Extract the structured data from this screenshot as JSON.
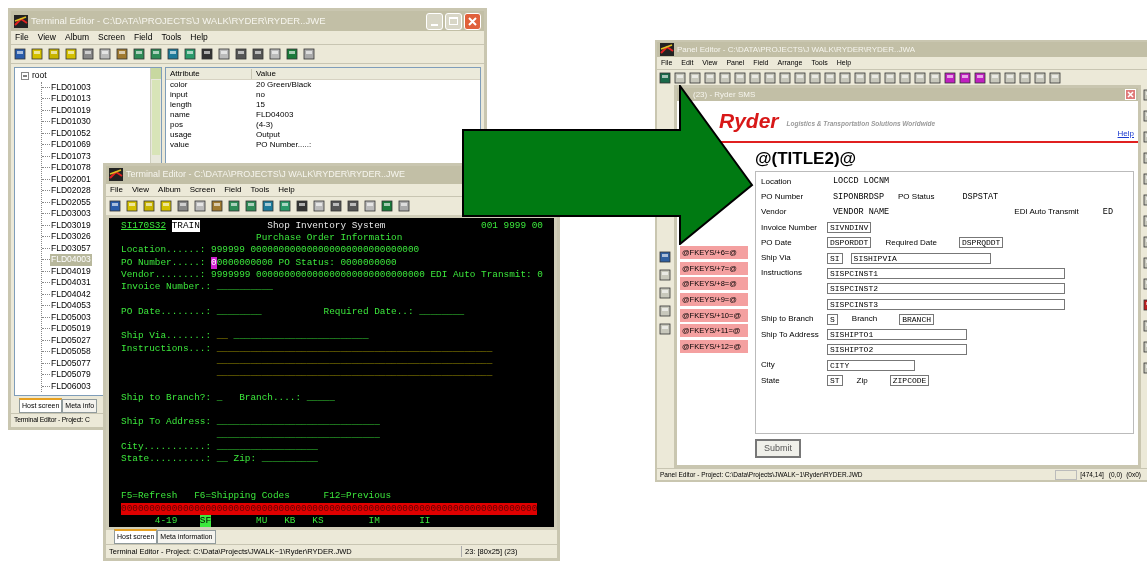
{
  "terminal_editor_back": {
    "title": "Terminal Editor - C:\\DATA\\PROJECTS\\J WALK\\RYDER\\RYDER..JWE",
    "menu": [
      "File",
      "View",
      "Album",
      "Screen",
      "Field",
      "Tools",
      "Help"
    ],
    "tree": {
      "label": "root",
      "expanded": true,
      "children": [
        {
          "label": "FLD01003",
          "selected": false
        },
        {
          "label": "FLD01013",
          "selected": false
        },
        {
          "label": "FLD01019",
          "selected": false
        },
        {
          "label": "FLD01030",
          "selected": false
        },
        {
          "label": "FLD01052",
          "selected": false
        },
        {
          "label": "FLD01069",
          "selected": false
        },
        {
          "label": "FLD01073",
          "selected": false
        },
        {
          "label": "FLD01078",
          "selected": false
        },
        {
          "label": "FLD02001",
          "selected": false
        },
        {
          "label": "FLD02028",
          "selected": false
        },
        {
          "label": "FLD02055",
          "selected": false
        },
        {
          "label": "FLD03003",
          "selected": false
        },
        {
          "label": "FLD03019",
          "selected": false
        },
        {
          "label": "FLD03026",
          "selected": false
        },
        {
          "label": "FLD03057",
          "selected": false
        },
        {
          "label": "FLD04003",
          "selected": true
        },
        {
          "label": "FLD04019",
          "selected": false
        },
        {
          "label": "FLD04031",
          "selected": false
        },
        {
          "label": "FLD04042",
          "selected": false
        },
        {
          "label": "FLD04053",
          "selected": false
        },
        {
          "label": "FLD05003",
          "selected": false
        },
        {
          "label": "FLD05019",
          "selected": false
        },
        {
          "label": "FLD05027",
          "selected": false
        },
        {
          "label": "FLD05058",
          "selected": false
        },
        {
          "label": "FLD05077",
          "selected": false
        },
        {
          "label": "FLD05079",
          "selected": false
        },
        {
          "label": "FLD06003",
          "selected": false
        }
      ]
    },
    "attributes": {
      "columns": [
        "Attribute",
        "Value"
      ],
      "rows": [
        {
          "attribute": "color",
          "value": "20 Green/Black"
        },
        {
          "attribute": "input",
          "value": "no"
        },
        {
          "attribute": "length",
          "value": "15"
        },
        {
          "attribute": "name",
          "value": "FLD04003"
        },
        {
          "attribute": "pos",
          "value": "(4-3)"
        },
        {
          "attribute": "usage",
          "value": "Output"
        },
        {
          "attribute": "value",
          "value": "PO Number.....:"
        }
      ]
    },
    "tabs": [
      {
        "label": "Host screen",
        "selected": true
      },
      {
        "label": "Meta info",
        "selected": false
      }
    ],
    "status": "Terminal Editor - Project: C"
  },
  "terminal_editor_front": {
    "title": "Terminal Editor - C:\\DATA\\PROJECTS\\J WALK\\RYDER\\RYDER..JWE",
    "menu": [
      "File",
      "View",
      "Album",
      "Screen",
      "Field",
      "Tools",
      "Help"
    ],
    "screen_lines": [
      {
        "segments": [
          {
            "kind": "link",
            "text": "SI170S32"
          },
          {
            "kind": "tag",
            "text": "TRAIN"
          },
          {
            "kind": "title",
            "text": "            Shop Inventory System"
          },
          {
            "kind": "text",
            "text": "                 001 9999 00"
          }
        ]
      },
      {
        "segments": [
          {
            "kind": "text",
            "text": "                        Purchase Order Information"
          }
        ]
      },
      {
        "segments": [
          {
            "kind": "text",
            "text": "Location......: 999999 000000000000000000000000000000"
          }
        ]
      },
      {
        "segments": [
          {
            "kind": "text",
            "text": "PO Number.....: "
          },
          {
            "kind": "cursor",
            "text": "0"
          },
          {
            "kind": "text",
            "text": "0000000000 PO Status: 0000000000"
          }
        ]
      },
      {
        "segments": [
          {
            "kind": "text",
            "text": "Vendor........: 9999999 000000000000000000000000000000 EDI Auto Transmit: 0"
          }
        ]
      },
      {
        "blank_after": true,
        "segments": [
          {
            "kind": "text",
            "text": "Invoice Number.: __________"
          }
        ]
      },
      {
        "blank_after": true,
        "segments": [
          {
            "kind": "text",
            "text": "PO Date........: ________           Required Date..: ________"
          }
        ]
      },
      {
        "segments": [
          {
            "kind": "text",
            "text": "Ship Via.......: "
          },
          {
            "kind": "yellow",
            "text": "__"
          },
          {
            "kind": "text",
            "text": " ________________________"
          }
        ]
      },
      {
        "segments": [
          {
            "kind": "text",
            "text": "Instructions...: "
          },
          {
            "kind": "yellow",
            "text": "_________________________________________________"
          }
        ]
      },
      {
        "segments": [
          {
            "kind": "yellow",
            "text": "                 _________________________________________________"
          }
        ]
      },
      {
        "blank_after": true,
        "segments": [
          {
            "kind": "yellow",
            "text": "                 _________________________________________________"
          }
        ]
      },
      {
        "blank_after": true,
        "segments": [
          {
            "kind": "text",
            "text": "Ship to Branch?: _   Branch....: _____"
          }
        ]
      },
      {
        "segments": [
          {
            "kind": "text",
            "text": "Ship To Address: _____________________________"
          }
        ]
      },
      {
        "segments": [
          {
            "kind": "text",
            "text": "                 _____________________________"
          }
        ]
      },
      {
        "segments": [
          {
            "kind": "text",
            "text": "City...........: __________________"
          }
        ]
      },
      {
        "blank_after": true,
        "segments": [
          {
            "kind": "text",
            "text": "State..........: __ Zip: __________"
          }
        ]
      },
      {
        "blank_before": true,
        "segments": [
          {
            "kind": "text",
            "text": "F5=Refresh   F6=Shipping Codes      F12=Previous"
          }
        ]
      },
      {
        "segments": [
          {
            "kind": "bar",
            "text": "00000000000000000000000000000000000000000000000000000000000000000000000000"
          }
        ]
      },
      {
        "segments": [
          {
            "kind": "text",
            "text": "      4-19    "
          },
          {
            "kind": "hilite",
            "text": "SF"
          },
          {
            "kind": "text",
            "text": "        MU   KB   KS        IM       II"
          }
        ]
      }
    ],
    "tabs": [
      {
        "label": "Host screen",
        "selected": true
      },
      {
        "label": "Meta information",
        "selected": false
      }
    ],
    "status": [
      "Terminal Editor - Project: C:\\Data\\Projects\\JWALK~1\\Ryder\\RYDER.JWD",
      "23: [80x25] (23)"
    ]
  },
  "panel_editor": {
    "title": "Panel Editor - C:\\DATA\\PROJECTS\\J WALK\\RYDER\\RYDER..JWA",
    "menu": [
      "File",
      "Edit",
      "View",
      "Panel",
      "Field",
      "Arrange",
      "Tools",
      "Help"
    ],
    "document": {
      "title": "(23) - Ryder SMS",
      "logo": "Ryder",
      "tagline": "Logistics & Transportation Solutions Worldwide",
      "help_link": "Help",
      "heading": "@(TITLE2)@",
      "fkeys": [
        "@FKEYS/+6=@",
        "@FKEYS/+7=@",
        "@FKEYS/+8=@",
        "@FKEYS/+9=@",
        "@FKEYS/+10=@",
        "@FKEYS/+11=@",
        "@FKEYS/+12=@"
      ],
      "form": [
        {
          "label": "Location",
          "items": [
            {
              "kind": "value",
              "text": "LOCCD LOCNM"
            }
          ]
        },
        {
          "label": "PO Number",
          "items": [
            {
              "kind": "value",
              "text": "SIPONBRDSP"
            },
            {
              "kind": "label",
              "text": "PO Status"
            },
            {
              "kind": "value",
              "text": "DSPSTAT"
            }
          ]
        },
        {
          "label": "Vendor",
          "items": [
            {
              "kind": "value",
              "text": "VENDOR NAME"
            },
            {
              "kind": "far_label",
              "text": "EDI Auto Transmit"
            },
            {
              "kind": "value",
              "text": "ED"
            }
          ]
        },
        {
          "label": "Invoice Number",
          "items": [
            {
              "kind": "field",
              "text": "SIVNDINV"
            }
          ]
        },
        {
          "label": "PO Date",
          "items": [
            {
              "kind": "field",
              "text": "DSPORDDT"
            },
            {
              "kind": "label",
              "text": "Required Date"
            },
            {
              "kind": "field",
              "text": "DSPRQDDT"
            }
          ]
        },
        {
          "label": "Ship Via",
          "items": [
            {
              "kind": "field",
              "text": "SI"
            },
            {
              "kind": "field_large",
              "text": "SISHIPVIA"
            }
          ]
        },
        {
          "label": "Instructions",
          "items": [
            {
              "kind": "field_xlarge",
              "text": "SISPCINST1"
            }
          ]
        },
        {
          "items": [
            {
              "kind": "field_xlarge",
              "text": "SISPCINST2"
            }
          ]
        },
        {
          "items": [
            {
              "kind": "field_xlarge",
              "text": "SISPCINST3"
            }
          ]
        },
        {
          "label": "Ship to Branch",
          "items": [
            {
              "kind": "field",
              "text": "S"
            },
            {
              "kind": "label",
              "text": "Branch"
            },
            {
              "kind": "field",
              "text": "BRANCH"
            }
          ]
        },
        {
          "label": "Ship To Address",
          "items": [
            {
              "kind": "field_large",
              "text": "SISHIPTO1"
            }
          ]
        },
        {
          "items": [
            {
              "kind": "field_large",
              "text": "SISHIPTO2"
            }
          ]
        },
        {
          "label": "City",
          "items": [
            {
              "kind": "field_medium",
              "text": "CITY"
            }
          ]
        },
        {
          "label": "State",
          "items": [
            {
              "kind": "field",
              "text": "ST"
            },
            {
              "kind": "label",
              "text": "Zip"
            },
            {
              "kind": "field",
              "text": "ZIPCODE"
            }
          ]
        }
      ],
      "submit": "Submit"
    },
    "status": [
      "Panel Editor  - Project: C:\\Data\\Projects\\JWALK~1\\Ryder\\RYDER.JWD",
      "[474,14]",
      "(0,0)",
      "(0x0)"
    ]
  }
}
